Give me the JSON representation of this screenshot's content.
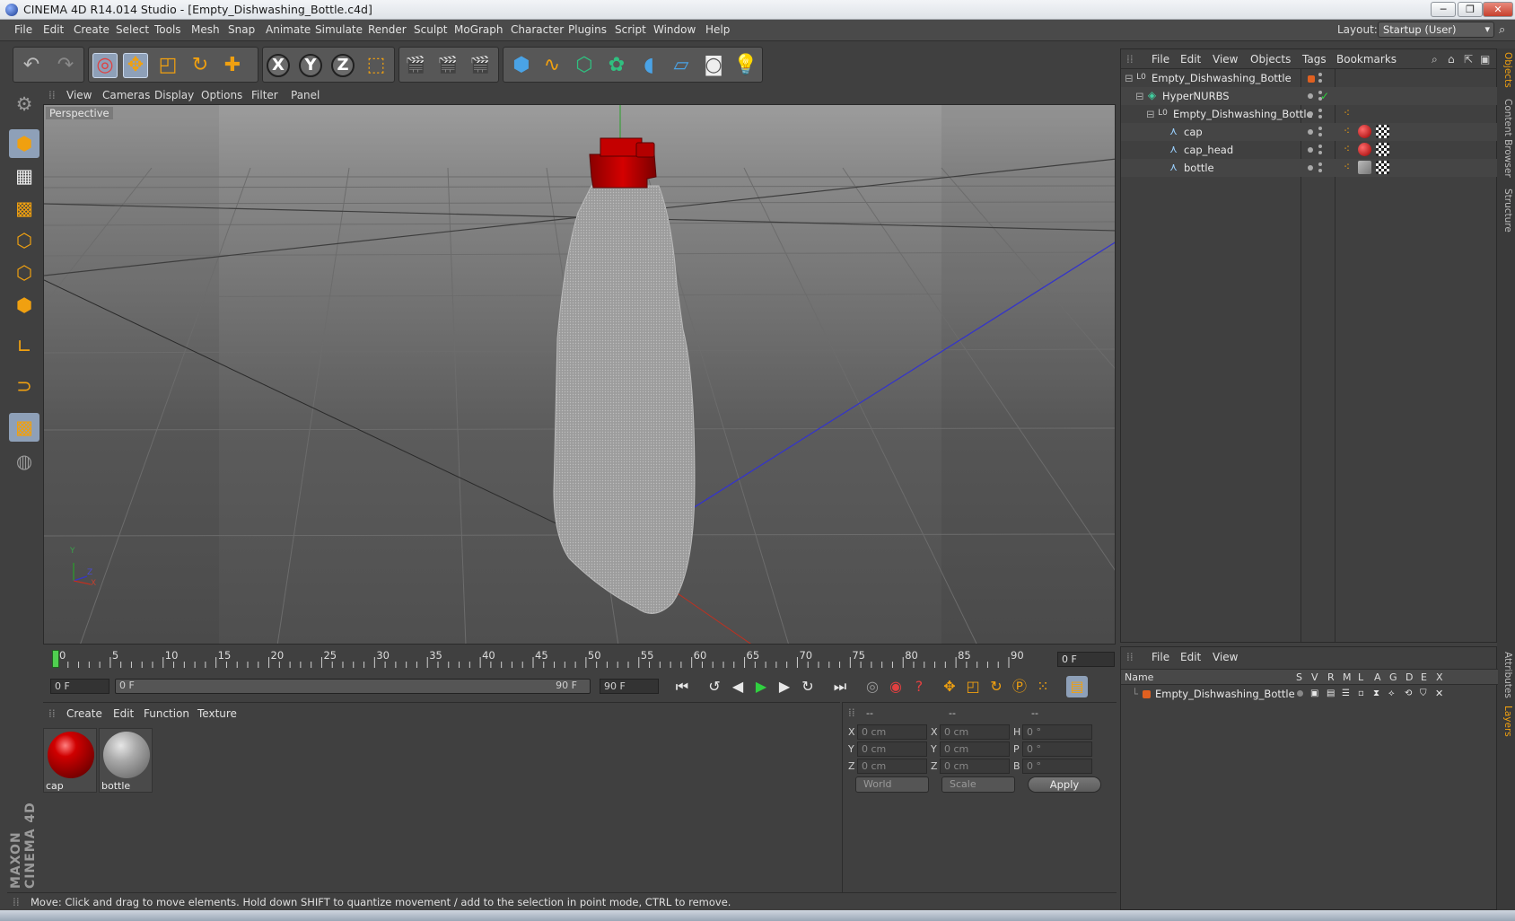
{
  "window": {
    "title": "CINEMA 4D R14.014 Studio - [Empty_Dishwashing_Bottle.c4d]",
    "minimize": "─",
    "restore": "❐",
    "close": "✕"
  },
  "menu": [
    "File",
    "Edit",
    "Create",
    "Select",
    "Tools",
    "Mesh",
    "Snap",
    "Animate",
    "Simulate",
    "Render",
    "Sculpt",
    "MoGraph",
    "Character",
    "Plugins",
    "Script",
    "Window",
    "Help"
  ],
  "layout": {
    "label": "Layout:",
    "value": "Startup (User)"
  },
  "viewport": {
    "menu": [
      "View",
      "Cameras",
      "Display",
      "Options",
      "Filter",
      "Panel"
    ],
    "label": "Perspective",
    "axis_x": "X",
    "axis_y": "Y",
    "axis_z": "Z"
  },
  "toolbar_axes": [
    "X",
    "Y",
    "Z"
  ],
  "timeline": {
    "ticks": [
      "0",
      "5",
      "10",
      "15",
      "20",
      "25",
      "30",
      "35",
      "40",
      "45",
      "50",
      "55",
      "60",
      "65",
      "70",
      "75",
      "80",
      "85",
      "90"
    ],
    "current": "0 F",
    "start": "0 F",
    "range_start": "0 F",
    "range_end": "90 F",
    "end": "90 F"
  },
  "materials": {
    "menu": [
      "Create",
      "Edit",
      "Function",
      "Texture"
    ],
    "items": [
      {
        "name": "cap"
      },
      {
        "name": "bottle"
      }
    ]
  },
  "coords": {
    "headers": [
      "--",
      "--",
      "--"
    ],
    "rows": [
      {
        "a": "X",
        "av": "0 cm",
        "b": "X",
        "bv": "0 cm",
        "c": "H",
        "cv": "0 °"
      },
      {
        "a": "Y",
        "av": "0 cm",
        "b": "Y",
        "bv": "0 cm",
        "c": "P",
        "cv": "0 °"
      },
      {
        "a": "Z",
        "av": "0 cm",
        "b": "Z",
        "bv": "0 cm",
        "c": "B",
        "cv": "0 °"
      }
    ],
    "mode1": "World",
    "mode2": "Scale",
    "apply": "Apply"
  },
  "status": "Move: Click and drag to move elements. Hold down SHIFT to quantize movement / add to the selection in point mode, CTRL to remove.",
  "objects": {
    "menu": [
      "File",
      "Edit",
      "View",
      "Objects",
      "Tags",
      "Bookmarks"
    ],
    "tree": [
      {
        "name": "Empty_Dishwashing_Bottle",
        "icon": "L0",
        "indent": 0
      },
      {
        "name": "HyperNURBS",
        "icon": "◈",
        "indent": 1
      },
      {
        "name": "Empty_Dishwashing_Bottle",
        "icon": "L0",
        "indent": 2
      },
      {
        "name": "cap",
        "icon": "⋏",
        "indent": 3
      },
      {
        "name": "cap_head",
        "icon": "⋏",
        "indent": 3
      },
      {
        "name": "bottle",
        "icon": "⋏",
        "indent": 3
      }
    ],
    "check": "✓"
  },
  "layers": {
    "menu": [
      "File",
      "Edit",
      "View"
    ],
    "headers": [
      "Name",
      "S",
      "V",
      "R",
      "M",
      "L",
      "A",
      "G",
      "D",
      "E",
      "X"
    ],
    "row": "Empty_Dishwashing_Bottle"
  },
  "sidetabs": [
    "Objects",
    "Content Browser",
    "Structure",
    "Attributes",
    "Layers"
  ],
  "brand": "MAXON CINEMA 4D",
  "colors": {
    "accent": "#f0a010",
    "cap_red": "#c00000",
    "axis_blue": "#3535c8",
    "axis_green": "#2aa02a",
    "axis_red": "#c03020"
  }
}
